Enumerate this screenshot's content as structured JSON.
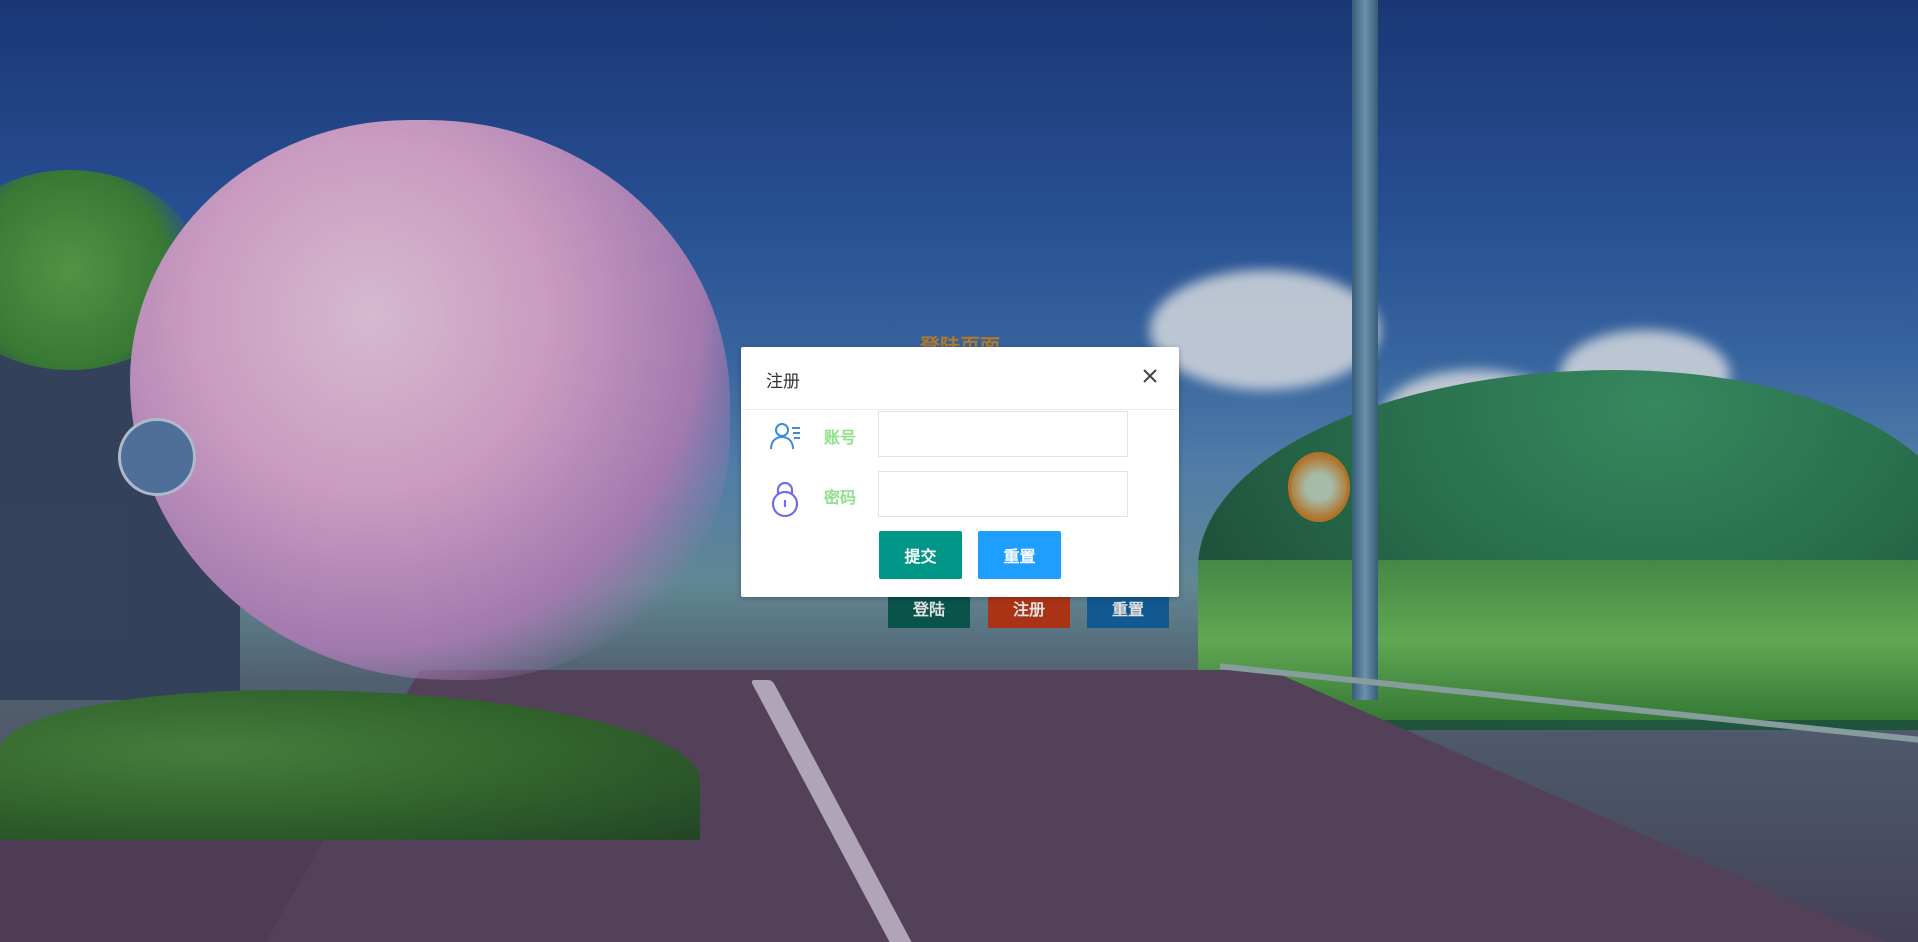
{
  "background": {
    "title": "登陆页面",
    "buttons": [
      {
        "label": "登陆",
        "color": "#0b5f56"
      },
      {
        "label": "注册",
        "color": "#c33b19"
      },
      {
        "label": "重置",
        "color": "#1566a6"
      }
    ]
  },
  "dialog": {
    "title": "注册",
    "close_icon": "close-icon",
    "fields": [
      {
        "label": "账号",
        "icon": "user-icon",
        "value": "",
        "placeholder": ""
      },
      {
        "label": "密码",
        "icon": "lock-icon",
        "value": "",
        "placeholder": ""
      }
    ],
    "buttons": {
      "submit": {
        "label": "提交",
        "color": "#009688"
      },
      "reset": {
        "label": "重置",
        "color": "#1e9fff"
      }
    }
  },
  "colors": {
    "label_green": "#8fe08a",
    "icon_blue": "#3f8bd7",
    "icon_purple": "#6f6fe6"
  }
}
